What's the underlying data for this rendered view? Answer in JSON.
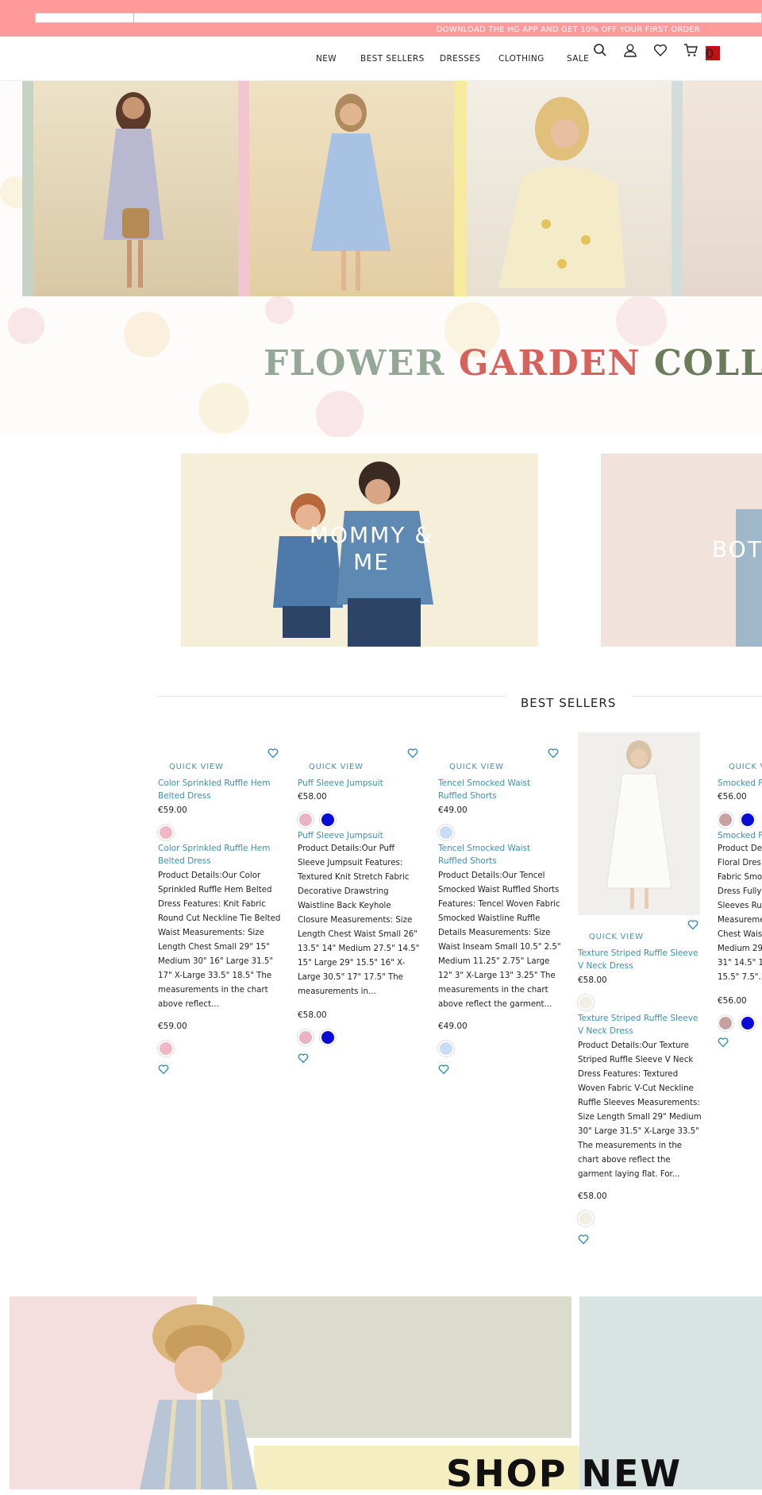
{
  "promo_bar": {
    "text": "DOWNLOAD THE HG APP AND GET 10% OFF YOUR FIRST ORDER"
  },
  "nav": {
    "items": [
      "NEW",
      "BEST SELLERS",
      "DRESSES",
      "CLOTHING",
      "SALE"
    ],
    "cart_count": "0",
    "icons": [
      "search-icon",
      "account-icon",
      "wishlist-icon",
      "cart-icon"
    ]
  },
  "hero": {
    "collection_words": [
      "FLOWER",
      "GARDEN",
      "COLL"
    ],
    "colors": {
      "word1": "#95a898",
      "word2": "#d7615b",
      "word3": "#6b7c5c"
    }
  },
  "banners": [
    {
      "title_line1": "MOMMY &",
      "title_line2": "ME"
    },
    {
      "title_line1": "BOT",
      "title_line2": ""
    }
  ],
  "best_sellers": {
    "title": "BEST SELLERS",
    "quick_view": "QUICK VIEW",
    "products": [
      {
        "name": "Color Sprinkled Ruffle Hem Belted Dress",
        "price": "€59.00",
        "swatches": [
          "#efb8c6"
        ],
        "description": "Product Details:Our Color Sprinkled Ruffle Hem Belted Dress Features: Knit Fabric Round Cut Neckline Tie Belted Waist Measurements: Size Length Chest Small 29\" 15\" Medium 30\" 16\" Large 31.5\" 17\" X-Large 33.5\" 18.5\" The measurements in the chart above reflect..."
      },
      {
        "name": "Puff Sleeve Jumpsuit",
        "price": "€58.00",
        "swatches": [
          "#e8b4c4",
          "#0a0ad6"
        ],
        "description": "Product Details:Our Puff Sleeve Jumpsuit Features: Textured Knit Stretch Fabric Decorative Drawstring Waistline Back Keyhole Closure Measurements: Size Length Chest Waist Small 26\" 13.5\" 14\" Medium 27.5\" 14.5\" 15\" Large 29\" 15.5\" 16\" X-Large 30.5\" 17\" 17.5\" The measurements in..."
      },
      {
        "name": "Tencel Smocked Waist Ruffled Shorts",
        "price": "€49.00",
        "swatches": [
          "#c9dcf6"
        ],
        "description": "Product Details:Our Tencel Smocked Waist Ruffled Shorts Features: Tencel Woven Fabric Smocked Waistline Ruffle Details Measurements: Size Waist Inseam Small 10.5\" 2.5\" Medium 11.25\" 2.75\" Large 12\" 3\" X-Large 13\" 3.25\" The measurements in the chart above reflect the garment..."
      },
      {
        "name": "Texture Striped Ruffle Sleeve V Neck Dress",
        "price": "€58.00",
        "swatches": [
          "#efefe6"
        ],
        "description": "Product Details:Our Texture Striped Ruffle Sleeve V Neck Dress Features: Textured Woven Fabric V-Cut Neckline Ruffle Sleeves Measurements: Size Length Small 29\" Medium 30\" Large 31.5\" X-Large 33.5\" The measurements in the chart above reflect the garment laying flat. For..."
      },
      {
        "name": "Smocked F",
        "name2": "Smocked F",
        "price": "€56.00",
        "swatches": [
          "#c9a0a2",
          "#0a0ad6"
        ],
        "description_lines": [
          "Product De",
          "Floral Dres",
          "Fabric Smo",
          "Dress Fully",
          "Sleeves Ruf",
          "Measureme",
          "Chest Wais",
          "Medium 29",
          "31\" 14.5\" 15",
          "15.5\" 7.5\"..."
        ]
      }
    ]
  },
  "bottom": {
    "headline": "SHOP NEW"
  }
}
